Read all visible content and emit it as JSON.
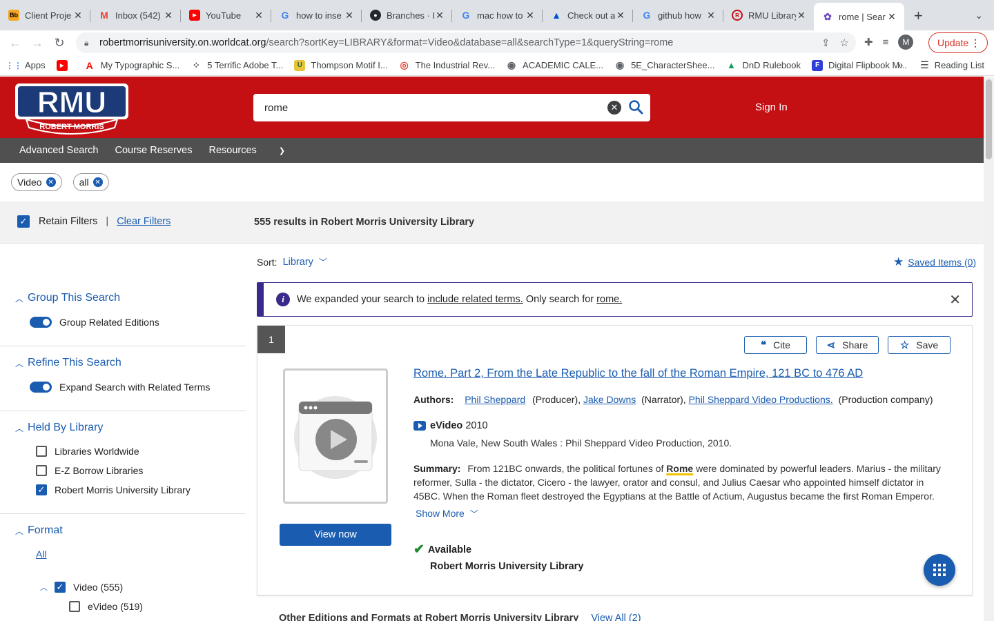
{
  "browser": {
    "tabs": [
      {
        "title": "Client Proje",
        "icon": "blackboard-icon",
        "color": "#f5a623"
      },
      {
        "title": "Inbox (542)",
        "icon": "gmail-icon",
        "color": "#ea4335"
      },
      {
        "title": "YouTube",
        "icon": "youtube-icon",
        "color": "#ff0000"
      },
      {
        "title": "how to inse",
        "icon": "google-icon",
        "color": "#4285f4"
      },
      {
        "title": "Branches · I",
        "icon": "github-icon",
        "color": "#24292e"
      },
      {
        "title": "mac how to",
        "icon": "google-icon",
        "color": "#4285f4"
      },
      {
        "title": "Check out a",
        "icon": "atlassian-icon",
        "color": "#0052cc"
      },
      {
        "title": "github how",
        "icon": "google-icon",
        "color": "#4285f4"
      },
      {
        "title": "RMU Library",
        "icon": "rmu-icon",
        "color": "#c40f13"
      },
      {
        "title": "rome | Sear",
        "icon": "worldcat-icon",
        "color": "#6b4fbb"
      }
    ],
    "url_host": "robertmorrisuniversity.on.worldcat.org",
    "url_path": "/search?sortKey=LIBRARY&format=Video&database=all&searchType=1&queryString=rome",
    "avatar_letter": "M",
    "update_label": "Update",
    "bookmarks": [
      {
        "label": "Apps",
        "icon": "apps-grid-icon"
      },
      {
        "label": "",
        "icon": "youtube-icon"
      },
      {
        "label": "My Typographic S...",
        "icon": "adobe-icon"
      },
      {
        "label": "5 Terrific Adobe T...",
        "icon": "camera-icon"
      },
      {
        "label": "Thompson Motif I...",
        "icon": "book-icon"
      },
      {
        "label": "The Industrial Rev...",
        "icon": "target-icon"
      },
      {
        "label": "ACADEMIC CALE...",
        "icon": "globe-icon"
      },
      {
        "label": "5E_CharacterShee...",
        "icon": "globe-icon"
      },
      {
        "label": "DnD Rulebook",
        "icon": "drive-icon"
      },
      {
        "label": "Digital Flipbook M...",
        "icon": "flipbook-icon"
      }
    ],
    "bookmarks_overflow": "»",
    "reading_list": "Reading List"
  },
  "header": {
    "logo_text": "RMU",
    "logo_sub": "ROBERT MORRIS",
    "search_value": "rome",
    "sign_in": "Sign In"
  },
  "subnav": {
    "advanced_search": "Advanced Search",
    "course_reserves": "Course Reserves",
    "resources": "Resources"
  },
  "chips": [
    {
      "label": "Video"
    },
    {
      "label": "all"
    }
  ],
  "filters_bar": {
    "retain_filters": "Retain Filters",
    "clear_filters": "Clear Filters",
    "results_count": "555 results in Robert Morris University Library"
  },
  "sidebar": {
    "group_title": "Group This Search",
    "group_toggle": "Group Related Editions",
    "refine_title": "Refine This Search",
    "refine_toggle": "Expand Search with Related Terms",
    "held_title": "Held By Library",
    "held_items": [
      {
        "label": "Libraries Worldwide",
        "checked": false
      },
      {
        "label": "E-Z Borrow Libraries",
        "checked": false
      },
      {
        "label": "Robert Morris University Library",
        "checked": true
      }
    ],
    "format_title": "Format",
    "format_all": "All",
    "format_video": "Video (555)",
    "format_evideo": "eVideo (519)"
  },
  "main": {
    "sort_label": "Sort:",
    "sort_value": "Library",
    "saved_items": "Saved Items (0)",
    "notice_pre": "We expanded your search to",
    "notice_link1": "include related terms.",
    "notice_mid": "Only search for",
    "notice_link2": "rome."
  },
  "result": {
    "number": "1",
    "cite": "Cite",
    "share": "Share",
    "save": "Save",
    "title": "Rome. Part 2, From the Late Republic to the fall of the Roman Empire, 121 BC to 476 AD",
    "authors_label": "Authors:",
    "authors": [
      {
        "name": "Phil Sheppard",
        "role": "(Producer),"
      },
      {
        "name": "Jake Downs",
        "role": "(Narrator),"
      },
      {
        "name": "Phil Sheppard Video Productions.",
        "role": "(Production company)"
      }
    ],
    "format": "eVideo",
    "year": "2010",
    "publisher": "Mona Vale, New South Wales : Phil Sheppard Video Production, 2010.",
    "summary_label": "Summary:",
    "summary_pre": "From 121BC onwards, the political fortunes of",
    "summary_hl": "Rome",
    "summary_post": "were dominated by powerful leaders. Marius - the military reformer, Sulla - the dictator, Cicero - the lawyer, orator and consul, and Julius Caesar who appointed himself dictator in 45BC. When the Roman fleet destroyed the Egyptians at the Battle of Actium, Augustus became the first Roman Emperor. The rule of",
    "show_more": "Show More",
    "view_now": "View now",
    "availability": "Available",
    "library": "Robert Morris University Library"
  },
  "other_editions": {
    "label": "Other Editions and Formats at Robert Morris University Library",
    "view_all": "View All (2)"
  },
  "colors": {
    "brand_red": "#c40f13",
    "link_blue": "#1a5cb0",
    "notice_purple": "#3a2a8c",
    "available_green": "#1d8a2c"
  }
}
